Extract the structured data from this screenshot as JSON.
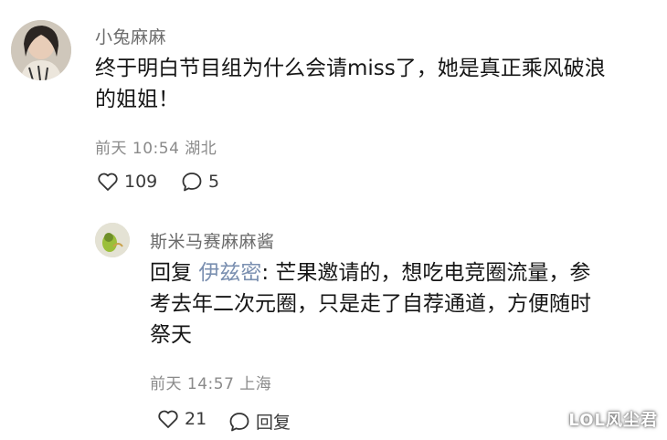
{
  "comment": {
    "username": "小兔麻麻",
    "text_line1": "终于明白节目组为什么会请miss了，她是真正乘风破浪",
    "text_line2": "的姐姐！",
    "meta": "前天 10:54 湖北",
    "likes": "109",
    "replies": "5"
  },
  "reply": {
    "username": "斯米马赛麻麻酱",
    "prefix": "回复 ",
    "mention": "伊兹密",
    "text_line1_rest": ": 芒果邀请的，想吃电竞圈流量，参",
    "text_line2": "考去年二次元圈，只是走了自荐通道，方便随时",
    "text_line3": "祭天",
    "meta": "前天 14:57 上海",
    "likes": "21",
    "reply_label": "回复"
  },
  "watermark": "LOL风尘君",
  "icons": {
    "like": "heart-outline-icon",
    "comment": "speech-bubble-icon"
  },
  "colors": {
    "mention": "#7a8fb0",
    "meta": "#8a8a8a",
    "username": "#6b6b6b"
  }
}
